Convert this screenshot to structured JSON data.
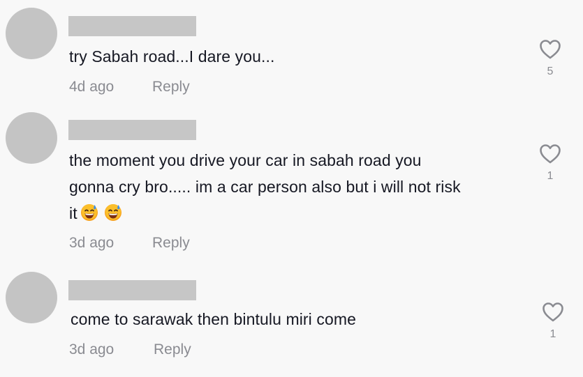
{
  "comments": [
    {
      "text": "try Sabah road...I dare you...",
      "time": "4d ago",
      "reply_label": "Reply",
      "likes": "5"
    },
    {
      "text_lines": [
        "the moment you drive your car in sabah road you",
        "gonna cry bro..... im a car person also but i will not risk",
        "it"
      ],
      "emojis": [
        "grinning-sweat-emoji",
        "grinning-sweat-emoji"
      ],
      "time": "3d ago",
      "reply_label": "Reply",
      "likes": "1"
    },
    {
      "text": "come to sarawak then bintulu miri come",
      "time": "3d ago",
      "reply_label": "Reply",
      "likes": "1"
    }
  ],
  "colors": {
    "background": "#f8f8f8",
    "avatar_placeholder": "#c4c4c4",
    "name_redaction": "#c6c6c6",
    "primary_text": "#161823",
    "secondary_text": "#8a8b91",
    "heart_outline": "#8a8b91"
  }
}
